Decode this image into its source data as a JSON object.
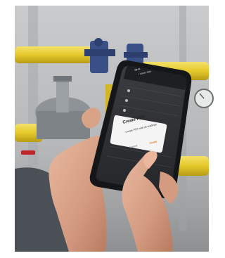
{
  "phone": {
    "status_time": "09:41",
    "header_title": "< Meter data",
    "dialog": {
      "title": "Create PDF",
      "message": "Create PDF with all readings",
      "cancel_label": "Cancel",
      "ok_label": "Create"
    }
  },
  "colors": {
    "pipe_yellow": "#e5c92b",
    "valve_blue": "#3a4f86",
    "phone_body": "#151618",
    "screen_dark": "#2b2d30",
    "accent_orange": "#e07b10"
  }
}
